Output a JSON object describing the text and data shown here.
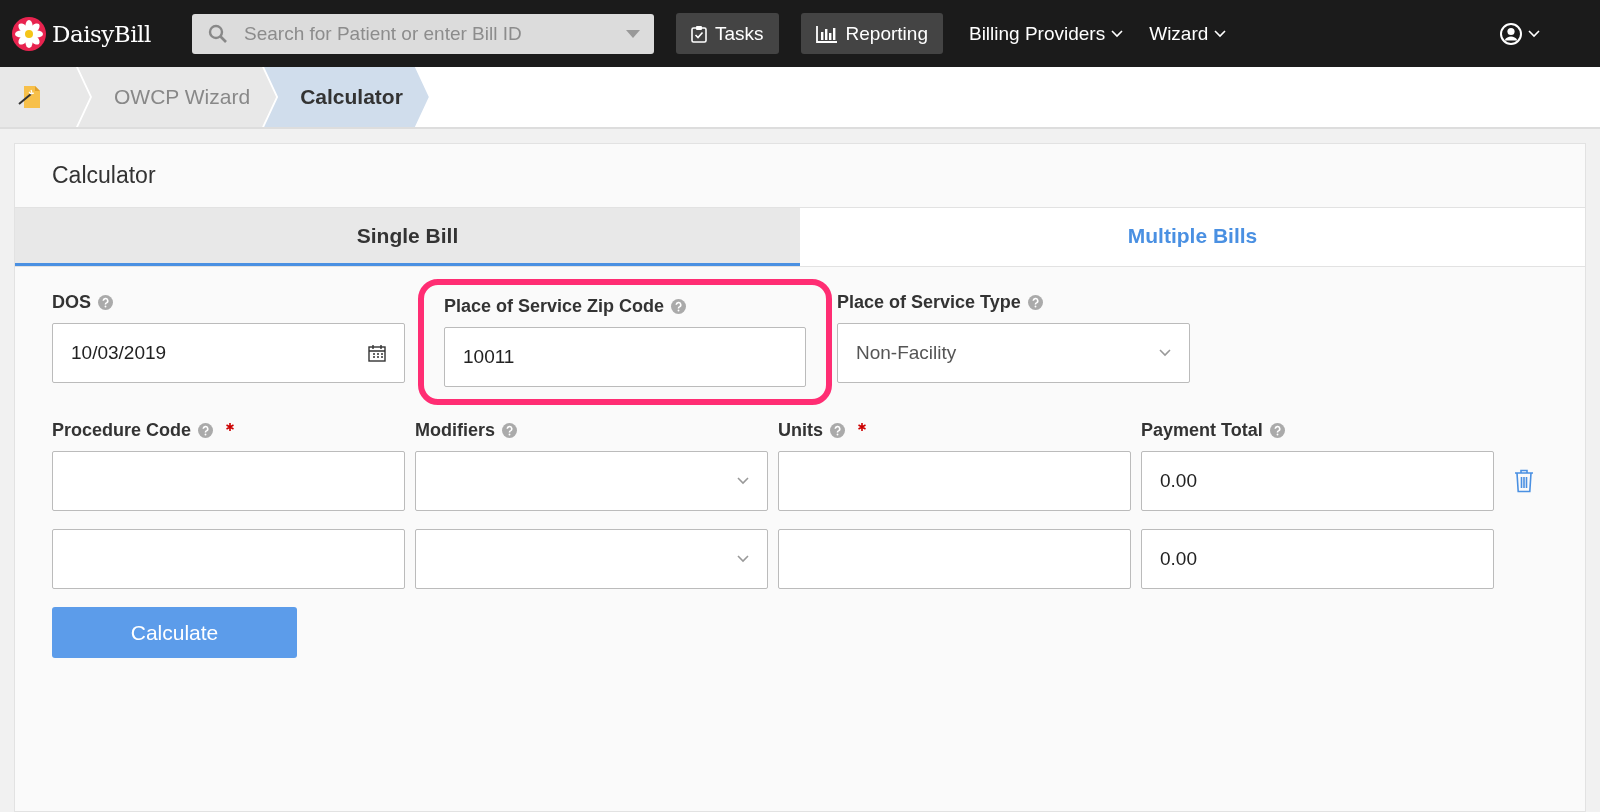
{
  "navbar": {
    "logo": "DaisyBill",
    "search": {
      "placeholder": "Search for Patient or enter Bill ID"
    },
    "items": [
      {
        "label": "Tasks",
        "kind": "button"
      },
      {
        "label": "Reporting",
        "kind": "button"
      },
      {
        "label": "Billing Providers",
        "kind": "menu"
      },
      {
        "label": "Wizard",
        "kind": "menu"
      }
    ]
  },
  "breadcrumb": [
    {
      "label": "OWCP Wizard",
      "selected": false
    },
    {
      "label": "Calculator",
      "selected": true
    }
  ],
  "card": {
    "title": "Calculator"
  },
  "tabs": [
    {
      "label": "Single Bill",
      "selected": true
    },
    {
      "label": "Multiple Bills",
      "selected": false
    }
  ],
  "top_fields": [
    {
      "label": "DOS",
      "kind": "date",
      "value": "10/03/2019",
      "highlighted": false
    },
    {
      "label": "Place of Service Zip Code",
      "kind": "text",
      "value": "10011",
      "highlighted": true
    },
    {
      "label": "Place of Service Type",
      "kind": "select",
      "value": "Non-Facility",
      "highlighted": false
    }
  ],
  "line_columns": [
    {
      "label": "Procedure Code",
      "required": true
    },
    {
      "label": "Modifiers",
      "required": false
    },
    {
      "label": "Units",
      "required": true
    },
    {
      "label": "Payment Total",
      "required": false
    }
  ],
  "lines": [
    {
      "payment_total": "0.00",
      "deletable": true
    },
    {
      "payment_total": "0.00",
      "deletable": false
    }
  ],
  "calculate_button": "Calculate"
}
